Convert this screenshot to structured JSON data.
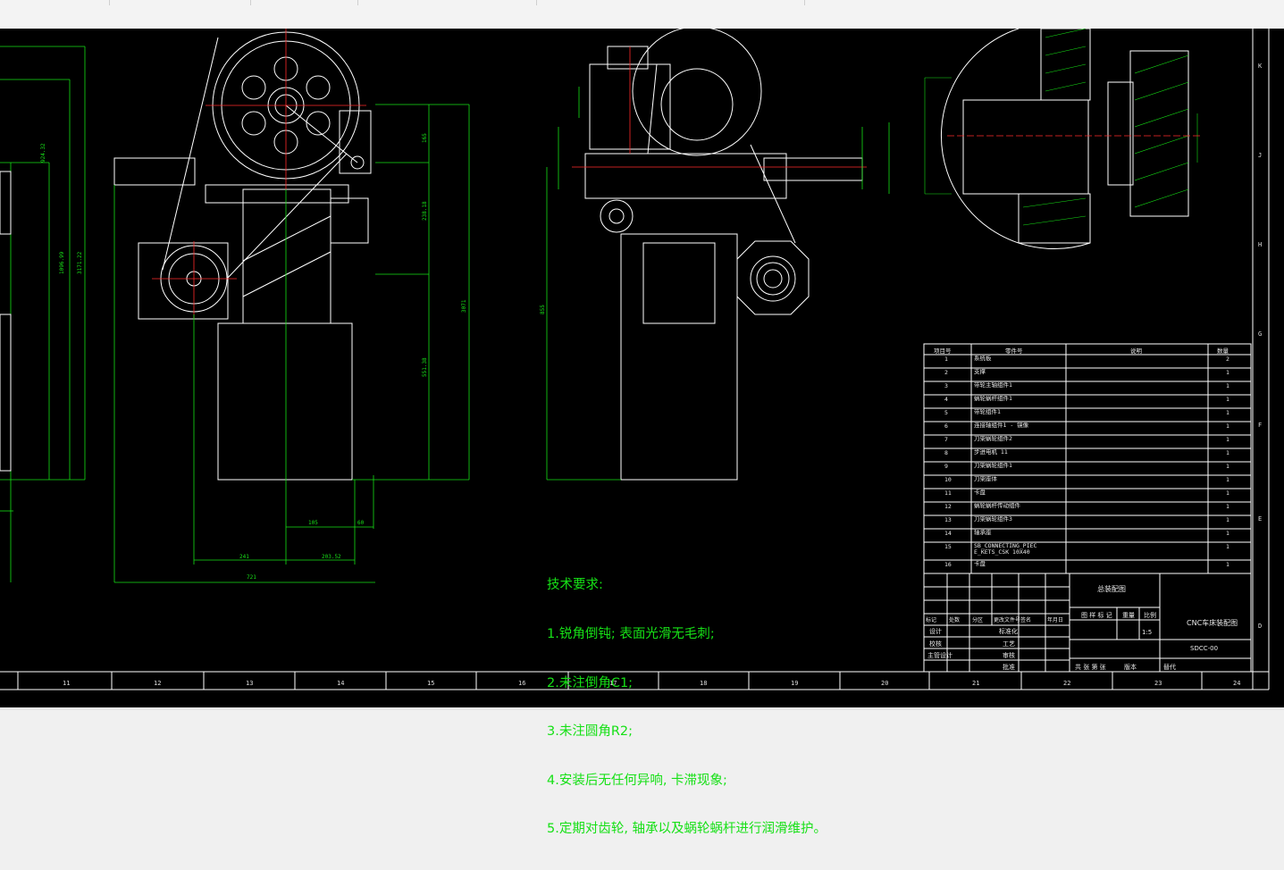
{
  "technical_requirements": {
    "title": "技术要求:",
    "items": [
      "1.锐角倒钝; 表面光滑无毛刺;",
      "2.未注倒角C1;",
      "3.未注圆角R2;",
      "4.安装后无任何异响, 卡滞现象;",
      "5.定期对齿轮, 轴承以及蜗轮蜗杆进行润滑维护。"
    ]
  },
  "bom": {
    "headers": [
      "项目号",
      "零件号",
      "说明",
      "数量"
    ],
    "rows": [
      {
        "no": "1",
        "part": "系统板",
        "qty": "2"
      },
      {
        "no": "2",
        "part": "支撑",
        "qty": "1"
      },
      {
        "no": "3",
        "part": "带轮主轴组件1",
        "qty": "1"
      },
      {
        "no": "4",
        "part": "蜗轮蜗杆组件1",
        "qty": "1"
      },
      {
        "no": "5",
        "part": "带轮组件1",
        "qty": "1"
      },
      {
        "no": "6",
        "part": "连接轴组件1 - 镜像",
        "qty": "1"
      },
      {
        "no": "7",
        "part": "刀架蜗轮组件2",
        "qty": "1"
      },
      {
        "no": "8",
        "part": "步进电机 11",
        "qty": "1"
      },
      {
        "no": "9",
        "part": "刀架蜗轮组件1",
        "qty": "1"
      },
      {
        "no": "10",
        "part": "刀架座体",
        "qty": "1"
      },
      {
        "no": "11",
        "part": "卡盘",
        "qty": "1"
      },
      {
        "no": "12",
        "part": "蜗轮蜗杆传动组件",
        "qty": "1"
      },
      {
        "no": "13",
        "part": "刀架蜗轮组件3",
        "qty": "1"
      },
      {
        "no": "14",
        "part": "轴承座",
        "qty": "1"
      },
      {
        "no": "15",
        "part": "SB_CONNECTING_PIEC\nE_KETS_CSK 10X40",
        "qty": "1"
      },
      {
        "no": "16",
        "part": "卡盘",
        "qty": "1"
      }
    ]
  },
  "title_block": {
    "assembly": "总装配图",
    "product": "CNC车床装配图",
    "drawing_no": "SDCC-00",
    "scale": "1:5",
    "sheet_labels": [
      "图 样 标 记",
      "重量",
      "比例"
    ],
    "signatures": [
      "设计",
      "校核",
      "主管设计"
    ],
    "standard": [
      "标准化",
      "工艺",
      "审核",
      "批准"
    ],
    "rev_labels": [
      "标记",
      "处数",
      "分区",
      "更改文件号",
      "签名",
      "年月日"
    ],
    "sheet": [
      "共 张 第 张",
      "版本",
      "替代"
    ]
  },
  "ruler": [
    "11",
    "12",
    "13",
    "14",
    "15",
    "16",
    "17",
    "18",
    "19",
    "20",
    "21",
    "22",
    "23",
    "24"
  ],
  "side_ruler": [
    "K",
    "J",
    "H",
    "G",
    "F",
    "E",
    "D",
    "C",
    "B"
  ],
  "dims": [
    "924.32",
    "3171.22",
    "1096.99",
    "241",
    "203.52",
    "721",
    "105",
    "60",
    "3071",
    "165",
    "238.18",
    "551.38",
    "855"
  ]
}
